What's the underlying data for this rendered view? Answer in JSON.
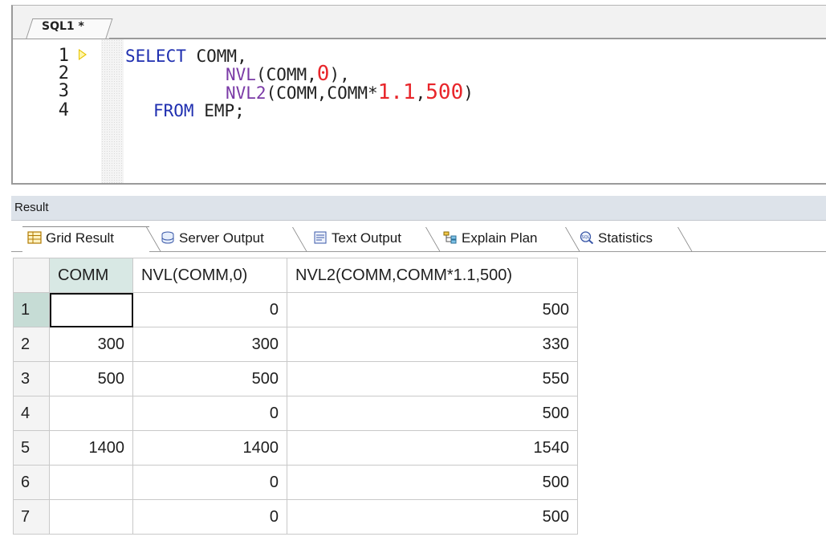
{
  "editor": {
    "tab_label": "SQL1 *",
    "line_numbers": [
      "1",
      "2",
      "3",
      "4"
    ],
    "lines": [
      {
        "keyword": "SELECT",
        "rest": " COMM,"
      },
      {
        "fn": "NVL",
        "open": "(COMM,",
        "n1": "0",
        "close": "),"
      },
      {
        "fn": "NVL2",
        "open": "(COMM,COMM*",
        "n1": "1.1",
        "sep": ",",
        "n2": "500",
        "close": ")"
      },
      {
        "keyword": "FROM",
        "rest": " EMP;"
      }
    ]
  },
  "result": {
    "title": "Result",
    "tabs": [
      {
        "label": "Grid Result",
        "icon": "grid-icon"
      },
      {
        "label": "Server Output",
        "icon": "server-output-icon"
      },
      {
        "label": "Text Output",
        "icon": "text-output-icon"
      },
      {
        "label": "Explain Plan",
        "icon": "explain-plan-icon"
      },
      {
        "label": "Statistics",
        "icon": "statistics-icon"
      }
    ],
    "columns": [
      "COMM",
      "NVL(COMM,0)",
      "NVL2(COMM,COMM*1.1,500)"
    ],
    "rows": [
      {
        "n": "1",
        "comm": "",
        "nvl": "0",
        "nvl2": "500"
      },
      {
        "n": "2",
        "comm": "300",
        "nvl": "300",
        "nvl2": "330"
      },
      {
        "n": "3",
        "comm": "500",
        "nvl": "500",
        "nvl2": "550"
      },
      {
        "n": "4",
        "comm": "",
        "nvl": "0",
        "nvl2": "500"
      },
      {
        "n": "5",
        "comm": "1400",
        "nvl": "1400",
        "nvl2": "1540"
      },
      {
        "n": "6",
        "comm": "",
        "nvl": "0",
        "nvl2": "500"
      },
      {
        "n": "7",
        "comm": "",
        "nvl": "0",
        "nvl2": "500"
      }
    ]
  },
  "colors": {
    "keyword": "#1f2fb0",
    "function": "#7a3aa6",
    "number": "#e8262b",
    "selected_header": "#d8e8e4"
  }
}
